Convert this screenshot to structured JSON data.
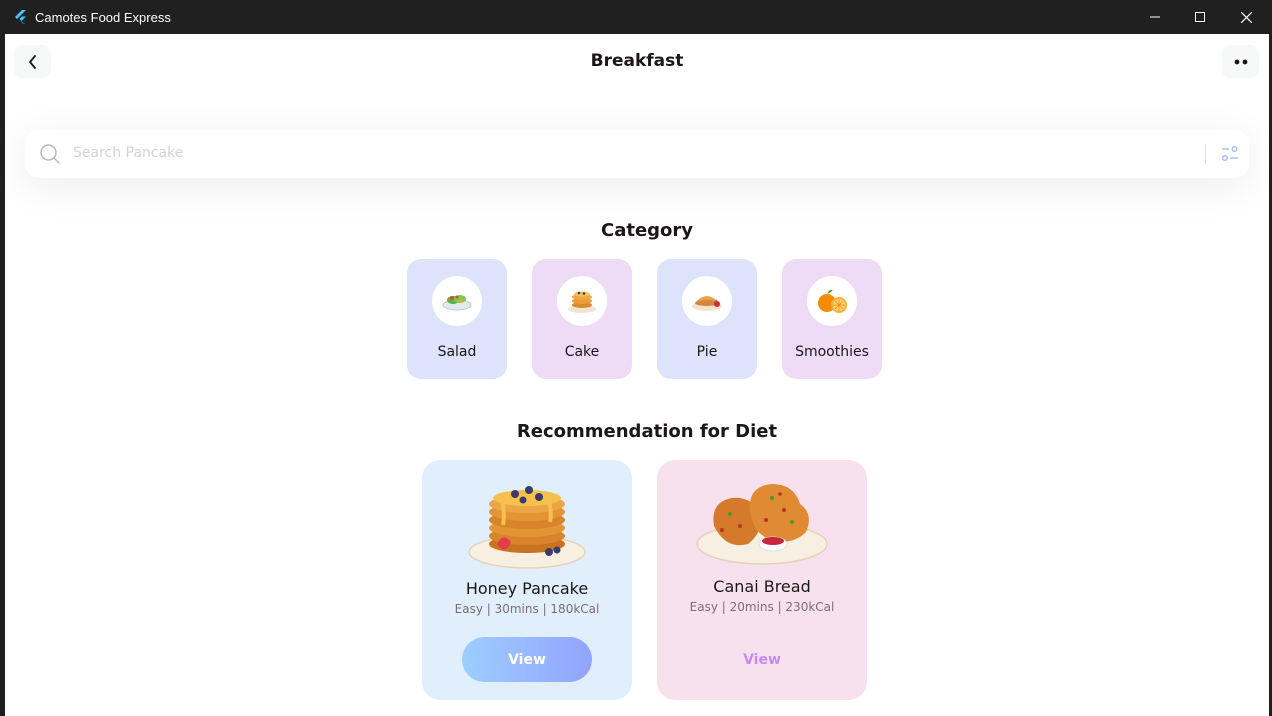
{
  "window": {
    "title": "Camotes Food Express",
    "app_icon": "flutter-logo-icon"
  },
  "header": {
    "title": "Breakfast",
    "back_icon": "chevron-left-icon",
    "more_icon": "more-dots-icon"
  },
  "search": {
    "placeholder": "Search Pancake",
    "search_icon": "search-icon",
    "filter_icon": "filter-icon"
  },
  "category": {
    "title": "Category",
    "items": [
      {
        "label": "Salad",
        "icon": "salad-icon",
        "color": "#dde3fb"
      },
      {
        "label": "Cake",
        "icon": "pancake-stack-icon",
        "color": "#eedcf7"
      },
      {
        "label": "Pie",
        "icon": "pie-icon",
        "color": "#dde3fb"
      },
      {
        "label": "Smoothies",
        "icon": "orange-icon",
        "color": "#eedcf7"
      }
    ]
  },
  "recommendation": {
    "title": "Recommendation for Diet",
    "items": [
      {
        "name": "Honey Pancake",
        "meta": "Easy | 30mins | 180kCal",
        "button": "View",
        "image": "honey-pancake-image",
        "button_style": "filled"
      },
      {
        "name": "Canai Bread",
        "meta": "Easy | 20mins | 230kCal",
        "button": "View",
        "image": "canai-bread-image",
        "button_style": "plain"
      }
    ]
  },
  "colors": {
    "accent_gradient_start": "#9dceff",
    "accent_gradient_end": "#92a3fd",
    "secondary_accent": "#c58bf2"
  }
}
